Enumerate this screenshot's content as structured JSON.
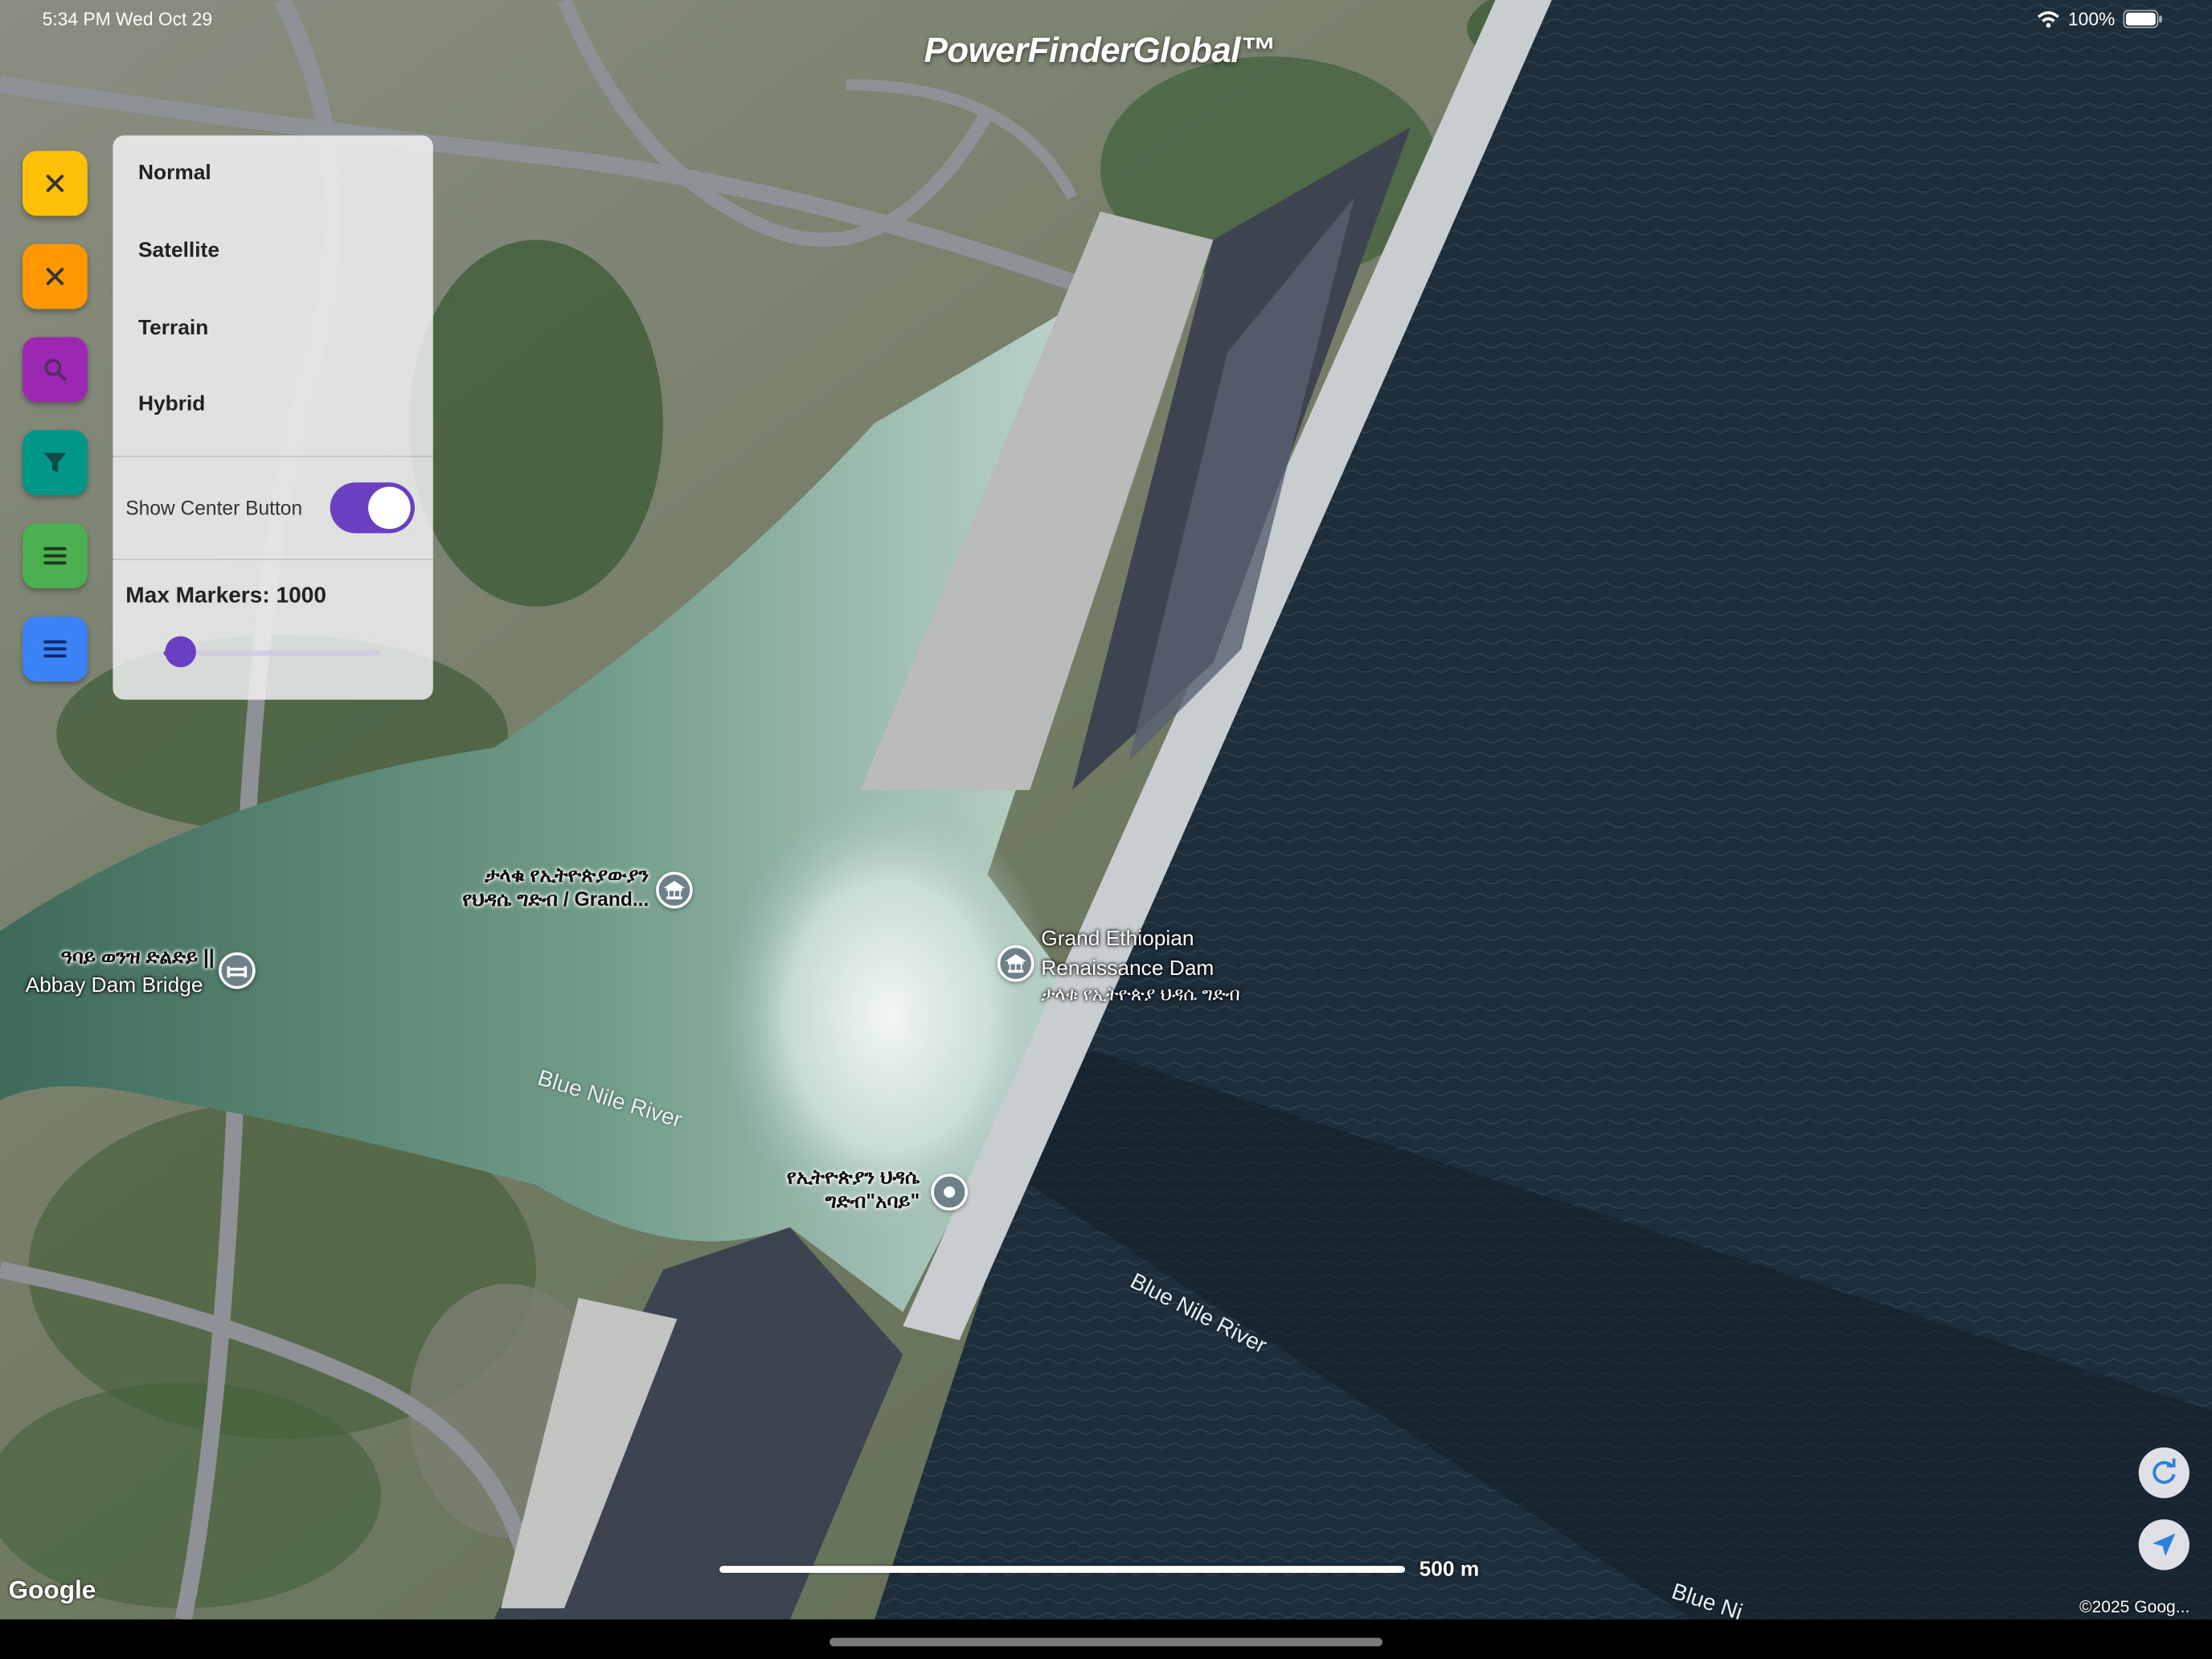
{
  "status": {
    "time": "5:34 PM",
    "date": "Wed Oct 29",
    "battery": "100%"
  },
  "app": {
    "title": "PowerFinderGlobal™"
  },
  "fabs": [
    {
      "icon": "close-icon",
      "color": "#FFC107"
    },
    {
      "icon": "close-icon",
      "color": "#FF9800"
    },
    {
      "icon": "search-icon",
      "color": "#9C27B0"
    },
    {
      "icon": "filter-icon",
      "color": "#009688"
    },
    {
      "icon": "menu-icon",
      "color": "#4CAF50"
    },
    {
      "icon": "menu-icon",
      "color": "#3B82F6"
    }
  ],
  "panel": {
    "map_types": [
      "Normal",
      "Satellite",
      "Terrain",
      "Hybrid"
    ],
    "show_center_label": "Show Center Button",
    "show_center_on": true,
    "max_markers_label": "Max Markers: 1000",
    "max_markers_value": 1000,
    "slider_fraction": 0.05,
    "accent": "#6A3FC0"
  },
  "map": {
    "labels": {
      "tekle_line1": "ታላቁ የኢትዮጵያውያን",
      "tekle_line2": "የህዳሴ ግድብ / Grand...",
      "bridge_line1": "ዓባይ ወንዝ ድልድይ ||",
      "bridge_line2": "Abbay Dam Bridge",
      "gerd_line1": "Grand Ethiopian",
      "gerd_line2": "Renaissance Dam",
      "gerd_line3": "ታላቁ የኢትዮጵያ ህዳሴ ግድብ",
      "hidase_line1": "የኢትዮጵያን ህዳሴ",
      "hidase_line2": "ግድብ\"አባይ\"",
      "river1": "Blue Nile River",
      "river2": "Blue Nile River",
      "river3": "Blue Ni"
    },
    "scale_label": "500 m",
    "google_logo": "Google",
    "copyright": "©2025 Goog..."
  }
}
